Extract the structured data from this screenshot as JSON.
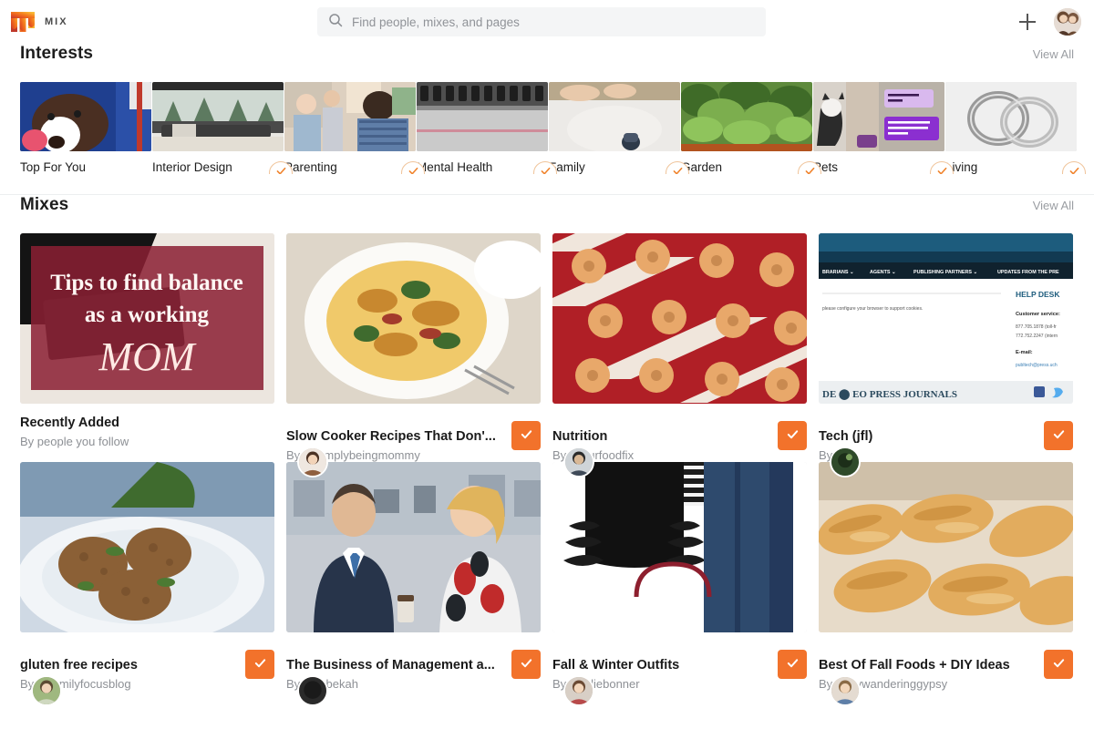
{
  "header": {
    "logo_text": "MIX",
    "logo_icon": "mix-logo-icon",
    "logo_colors": [
      "#c0392b",
      "#e8591f",
      "#f58220",
      "#f9b233",
      "#f5c842"
    ],
    "search": {
      "placeholder": "Find people, mixes, and pages",
      "value": "",
      "icon": "search-icon"
    },
    "add_icon": "plus-icon",
    "avatar_name": "user-avatar"
  },
  "interests_section": {
    "title": "Interests",
    "view_all_label": "View All",
    "items": [
      {
        "label": "Top For You",
        "followed": false,
        "image": "dog-in-blue-blanket"
      },
      {
        "label": "Interior Design",
        "followed": true,
        "image": "living-room-window-pines"
      },
      {
        "label": "Parenting",
        "followed": true,
        "image": "classroom-people"
      },
      {
        "label": "Mental Health",
        "followed": true,
        "image": "gym-dumbbell-rack"
      },
      {
        "label": "Family",
        "followed": true,
        "image": "baby-feet-white"
      },
      {
        "label": "Garden",
        "followed": true,
        "image": "green-garden-plants"
      },
      {
        "label": "Pets",
        "followed": true,
        "image": "cat-and-purple-texts"
      },
      {
        "label": "Living",
        "followed": true,
        "image": "silver-wedding-rings"
      }
    ]
  },
  "mixes_section": {
    "title": "Mixes",
    "view_all_label": "View All",
    "accent_color": "#f2722b",
    "items": [
      {
        "title": "Recently Added",
        "subtitle": "By people you follow",
        "has_avatar": false,
        "followed": false,
        "image": "tips-to-find-balance-mom-card",
        "image_text": [
          "Tips to find balance",
          "as a working",
          "MOM"
        ]
      },
      {
        "title": "Slow Cooker Recipes That Don'...",
        "subtitle": "By @simplybeingmommy",
        "has_avatar": true,
        "followed": true,
        "image": "frittata-plate-food"
      },
      {
        "title": "Nutrition",
        "subtitle": "By @ourfoodfix",
        "has_avatar": true,
        "followed": true,
        "image": "glazed-donuts-red-stripes"
      },
      {
        "title": "Tech (jfl)",
        "subtitle": "By @jfl",
        "has_avatar": true,
        "followed": true,
        "image": "publisher-website-screenshot",
        "image_text": [
          "BRARIANS",
          "AGENTS",
          "PUBLISHING PARTNERS",
          "UPDATES FROM THE PRE",
          "HELP DESK",
          "please configure your browser to support cookies.",
          "Customer service:",
          "877.705.1878 (toll-fr",
          "772.752.2247 (intern",
          "E-mail:",
          "publtech@press.uch"
        ]
      },
      {
        "title": "gluten free recipes",
        "subtitle": "By @familyfocusblog",
        "has_avatar": true,
        "followed": true,
        "image": "meatballs-on-plate"
      },
      {
        "title": "The Business of Management a...",
        "subtitle": "By @rebekah",
        "has_avatar": true,
        "followed": true,
        "image": "office-man-and-woman-talking"
      },
      {
        "title": "Fall & Winter Outfits",
        "subtitle": "By @juliebonner",
        "has_avatar": true,
        "followed": true,
        "image": "black-ruffle-top-and-jeans"
      },
      {
        "title": "Best Of Fall Foods + DIY Ideas",
        "subtitle": "By @lilywanderinggypsy",
        "has_avatar": true,
        "followed": true,
        "image": "baked-pastries-golden"
      }
    ]
  }
}
